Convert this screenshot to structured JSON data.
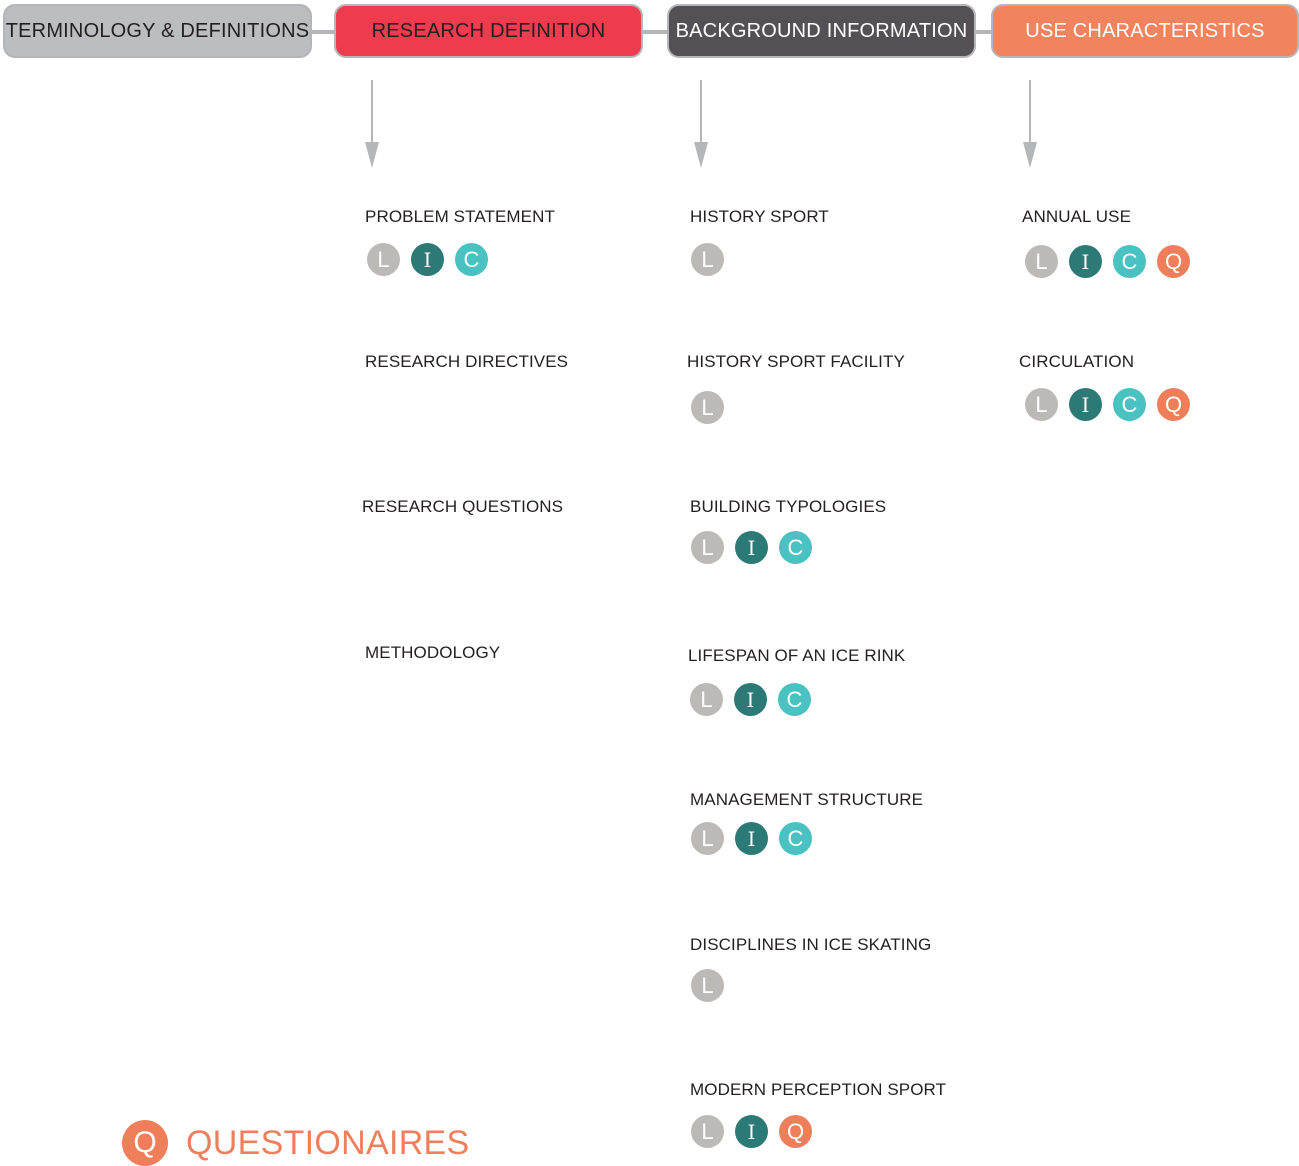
{
  "colors": {
    "L": "#bcbab6",
    "I": "#2b7a76",
    "C": "#49c2c1",
    "Q": "#ef7f5a"
  },
  "headers": {
    "terminology": "TERMINOLOGY &  DEFINITIONS",
    "research_definition": "RESEARCH DEFINITION",
    "background_information": "BACKGROUND INFORMATION",
    "use_characteristics": "USE CHARACTERISTICS"
  },
  "research_definition": [
    {
      "title": "PROBLEM STATEMENT",
      "badges": [
        "L",
        "I",
        "C"
      ]
    },
    {
      "title": "RESEARCH DIRECTIVES",
      "badges": []
    },
    {
      "title": "RESEARCH QUESTIONS",
      "badges": []
    },
    {
      "title": "METHODOLOGY",
      "badges": []
    }
  ],
  "background_information": [
    {
      "title": "HISTORY SPORT",
      "badges": [
        "L"
      ]
    },
    {
      "title": "HISTORY SPORT FACILITY",
      "badges": [
        "L"
      ]
    },
    {
      "title": "BUILDING TYPOLOGIES",
      "badges": [
        "L",
        "I",
        "C"
      ]
    },
    {
      "title": "LIFESPAN OF AN ICE RINK",
      "badges": [
        "L",
        "I",
        "C"
      ]
    },
    {
      "title": "MANAGEMENT STRUCTURE",
      "badges": [
        "L",
        "I",
        "C"
      ]
    },
    {
      "title": "DISCIPLINES IN ICE SKATING",
      "badges": [
        "L"
      ]
    },
    {
      "title": "MODERN PERCEPTION SPORT",
      "badges": [
        "L",
        "I",
        "Q"
      ]
    }
  ],
  "use_characteristics": [
    {
      "title": "ANNUAL USE",
      "badges": [
        "L",
        "I",
        "C",
        "Q"
      ]
    },
    {
      "title": "CIRCULATION",
      "badges": [
        "L",
        "I",
        "C",
        "Q"
      ]
    }
  ],
  "legend": {
    "badge": "Q",
    "label": "QUESTIONAIRES"
  }
}
